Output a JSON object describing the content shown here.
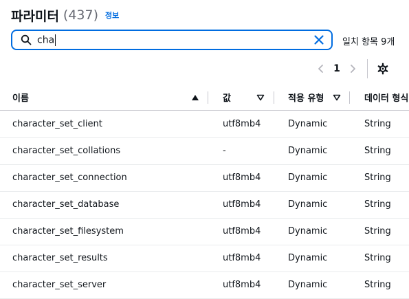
{
  "header": {
    "title": "파라미터",
    "count": "(437)",
    "info_link": "정보"
  },
  "search": {
    "value": "cha",
    "placeholder": ""
  },
  "match_count": "일치 항목 9개",
  "pagination": {
    "current_page": "1"
  },
  "table": {
    "columns": [
      "이름",
      "값",
      "적용 유형",
      "데이터 형식"
    ],
    "rows": [
      {
        "name": "character_set_client",
        "value": "utf8mb4",
        "apply_type": "Dynamic",
        "data_type": "String"
      },
      {
        "name": "character_set_collations",
        "value": "-",
        "apply_type": "Dynamic",
        "data_type": "String"
      },
      {
        "name": "character_set_connection",
        "value": "utf8mb4",
        "apply_type": "Dynamic",
        "data_type": "String"
      },
      {
        "name": "character_set_database",
        "value": "utf8mb4",
        "apply_type": "Dynamic",
        "data_type": "String"
      },
      {
        "name": "character_set_filesystem",
        "value": "utf8mb4",
        "apply_type": "Dynamic",
        "data_type": "String"
      },
      {
        "name": "character_set_results",
        "value": "utf8mb4",
        "apply_type": "Dynamic",
        "data_type": "String"
      },
      {
        "name": "character_set_server",
        "value": "utf8mb4",
        "apply_type": "Dynamic",
        "data_type": "String"
      }
    ]
  },
  "icons": {
    "search": "search-icon",
    "clear": "close-icon",
    "prev": "chevron-left-icon",
    "next": "chevron-right-icon",
    "settings": "gear-icon",
    "sort_asc": "sort-ascending-icon",
    "sort": "sort-caret-down-icon"
  },
  "colors": {
    "accent": "#006ce0",
    "text": "#0f141a",
    "muted": "#656871",
    "border": "#c6c6cd",
    "disabled": "#b4b4bb"
  }
}
